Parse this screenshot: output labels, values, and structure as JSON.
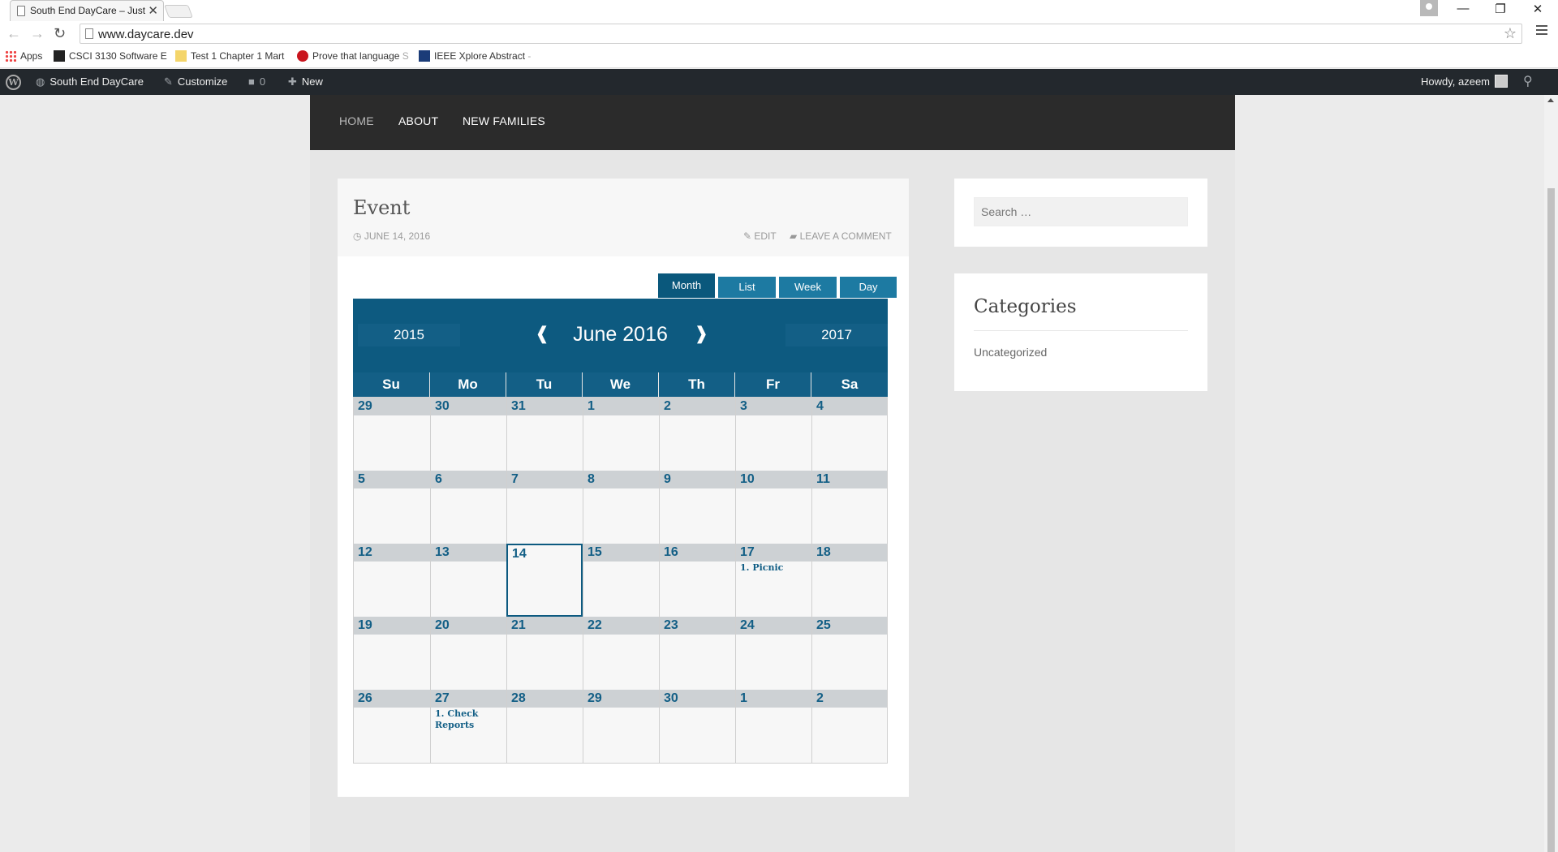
{
  "browser": {
    "tab_title": "South End DayCare – Just",
    "tab_close": "✕",
    "url": "www.daycare.dev",
    "window_buttons": {
      "minimize": "—",
      "restore": "❐",
      "close": "✕"
    },
    "nav": {
      "back": "←",
      "forward": "→",
      "reload": "↻",
      "star": "☆"
    },
    "bookmarks": [
      {
        "label": "Apps"
      },
      {
        "label": "CSCI 3130 Software E",
        "fade": ""
      },
      {
        "label": "Test 1 Chapter 1 Mart",
        "fade": ""
      },
      {
        "label": "Prove that language",
        "fade": " S"
      },
      {
        "label": "IEEE Xplore Abstract",
        "fade": " -"
      }
    ]
  },
  "adminbar": {
    "site_name": "South End DayCare",
    "customize": "Customize",
    "comments_count": "0",
    "new": "New",
    "howdy": "Howdy, azeem"
  },
  "site_nav": [
    "HOME",
    "ABOUT",
    "NEW FAMILIES"
  ],
  "article": {
    "title": "Event",
    "date": "JUNE 14, 2016",
    "edit": "EDIT",
    "comment": "LEAVE A COMMENT"
  },
  "calendar": {
    "views": [
      "Month",
      "List",
      "Week",
      "Day"
    ],
    "active_view": "Month",
    "prev_year": "2015",
    "next_year": "2017",
    "prev_arrow": "❰",
    "next_arrow": "❱",
    "month_label": "June 2016",
    "weekdays": [
      "Su",
      "Mo",
      "Tu",
      "We",
      "Th",
      "Fr",
      "Sa"
    ],
    "weeks": [
      [
        {
          "d": "29"
        },
        {
          "d": "30"
        },
        {
          "d": "31"
        },
        {
          "d": "1"
        },
        {
          "d": "2"
        },
        {
          "d": "3"
        },
        {
          "d": "4"
        }
      ],
      [
        {
          "d": "5"
        },
        {
          "d": "6"
        },
        {
          "d": "7"
        },
        {
          "d": "8"
        },
        {
          "d": "9"
        },
        {
          "d": "10"
        },
        {
          "d": "11"
        }
      ],
      [
        {
          "d": "12"
        },
        {
          "d": "13"
        },
        {
          "d": "14",
          "today": true
        },
        {
          "d": "15"
        },
        {
          "d": "16"
        },
        {
          "d": "17",
          "events": [
            "1.   Picnic"
          ]
        },
        {
          "d": "18"
        }
      ],
      [
        {
          "d": "19"
        },
        {
          "d": "20"
        },
        {
          "d": "21"
        },
        {
          "d": "22"
        },
        {
          "d": "23"
        },
        {
          "d": "24"
        },
        {
          "d": "25"
        }
      ],
      [
        {
          "d": "26"
        },
        {
          "d": "27",
          "events": [
            "1.   Check",
            "Reports"
          ]
        },
        {
          "d": "28"
        },
        {
          "d": "29"
        },
        {
          "d": "30"
        },
        {
          "d": "1"
        },
        {
          "d": "2"
        }
      ]
    ]
  },
  "sidebar": {
    "search_placeholder": "Search …",
    "categories_title": "Categories",
    "categories": [
      "Uncategorized"
    ]
  }
}
